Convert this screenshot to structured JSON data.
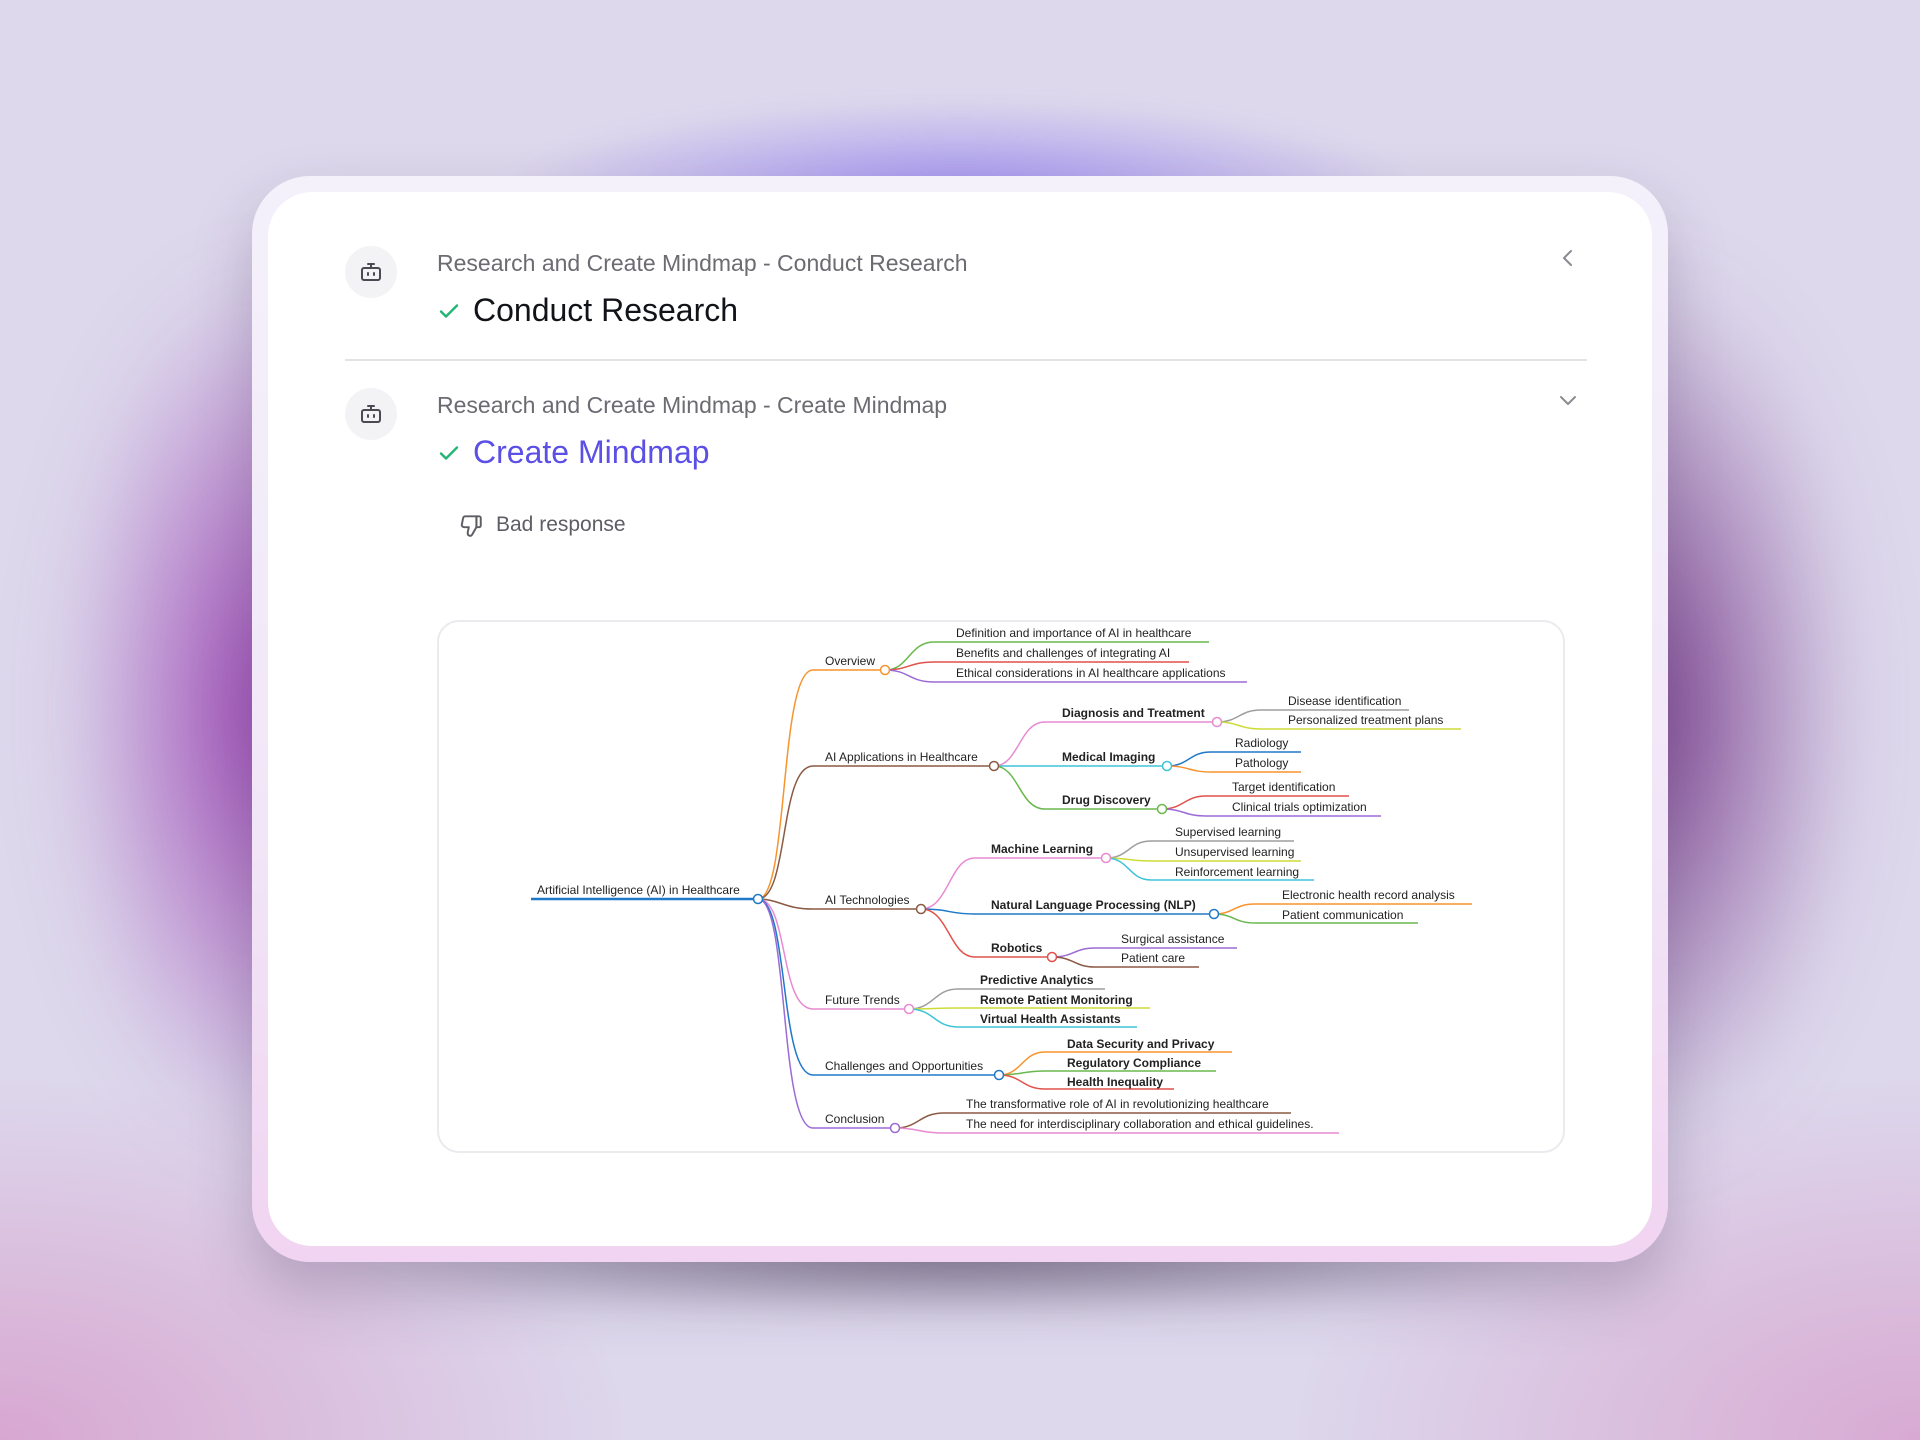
{
  "steps": [
    {
      "subtitle": "Research and Create Mindmap - Conduct Research",
      "title": "Conduct Research",
      "status": "completed",
      "avatar_icon": "bot-icon",
      "toggle_icon": "chevron-left-icon"
    },
    {
      "subtitle": "Research and Create Mindmap - Create Mindmap",
      "title": "Create Mindmap",
      "status": "completed",
      "avatar_icon": "bot-icon",
      "toggle_icon": "chevron-down-icon",
      "title_color": "#5b4fe6"
    }
  ],
  "feedback": {
    "label": "Bad response",
    "icon": "thumbs-down-icon"
  },
  "mindmap": {
    "root": "Artificial Intelligence (AI) in Healthcare",
    "branches": {
      "overview": {
        "label": "Overview",
        "children": [
          "Definition and importance of AI in healthcare",
          "Benefits and challenges of integrating AI",
          "Ethical considerations in AI healthcare applications"
        ]
      },
      "applications": {
        "label": "AI Applications in Healthcare",
        "diagnosis": {
          "label": "Diagnosis and Treatment",
          "children": [
            "Disease identification",
            "Personalized treatment plans"
          ]
        },
        "imaging": {
          "label": "Medical Imaging",
          "children": [
            "Radiology",
            "Pathology"
          ]
        },
        "drug": {
          "label": "Drug Discovery",
          "children": [
            "Target identification",
            "Clinical trials optimization"
          ]
        }
      },
      "technologies": {
        "label": "AI Technologies",
        "ml": {
          "label": "Machine Learning",
          "children": [
            "Supervised learning",
            "Unsupervised learning",
            "Reinforcement learning"
          ]
        },
        "nlp": {
          "label": "Natural Language Processing (NLP)",
          "children": [
            "Electronic health record analysis",
            "Patient communication"
          ]
        },
        "robotics": {
          "label": "Robotics",
          "children": [
            "Surgical assistance",
            "Patient care"
          ]
        }
      },
      "future": {
        "label": "Future Trends",
        "children": [
          "Predictive Analytics",
          "Remote Patient Monitoring",
          "Virtual Health Assistants"
        ]
      },
      "challenges": {
        "label": "Challenges and Opportunities",
        "children": [
          "Data Security and Privacy",
          "Regulatory Compliance",
          "Health Inequality"
        ]
      },
      "conclusion": {
        "label": "Conclusion",
        "children": [
          "The transformative role of AI in revolutionizing healthcare",
          "The need for interdisciplinary collaboration and ethical guidelines."
        ]
      }
    }
  }
}
